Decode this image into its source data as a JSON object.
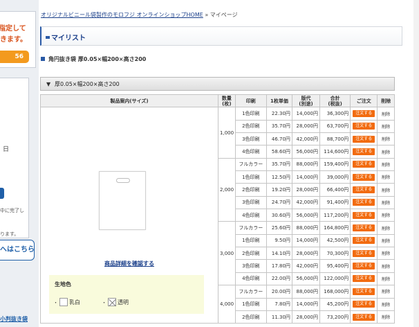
{
  "sidebar": {
    "banner_line1": "指定して",
    "banner_line2": "きます。",
    "banner_button": "56",
    "day_text": "日",
    "text1": "中に完了し",
    "text2": "",
    "text3": "ります。",
    "cta": "へはこちら",
    "bottom_link": "小判抜き袋"
  },
  "breadcrumb": {
    "home_link": "オリジナルビニール袋製作のモロフジ オンラインショップHOME",
    "separator": " » ",
    "current": "マイページ"
  },
  "header": {
    "title": "マイリスト"
  },
  "product": {
    "title": "角円抜き袋 厚0.05×幅200×高さ200",
    "section_label": "厚0.05×幅200×高さ200",
    "detail_link": "商品詳細を確認する",
    "color_heading": "生地色",
    "colors": [
      "乳白",
      "透明"
    ]
  },
  "table": {
    "headers": {
      "info": "製品案内(サイズ)",
      "qty": "数量\n(枚)",
      "print": "印刷",
      "unit": "1枚単価",
      "plate": "版代\n(別途)",
      "total": "合計\n(税抜)",
      "order": "ご注文",
      "delete": "削除"
    },
    "order_label": "注文する",
    "delete_label": "削除",
    "groups": [
      {
        "qty": "1,000",
        "rows": [
          {
            "print": "1色印刷",
            "unit": "22.30円",
            "plate": "14,000円",
            "total": "36,300円"
          },
          {
            "print": "2色印刷",
            "unit": "35.70円",
            "plate": "28,000円",
            "total": "63,700円"
          },
          {
            "print": "3色印刷",
            "unit": "46.70円",
            "plate": "42,000円",
            "total": "88,700円"
          },
          {
            "print": "4色印刷",
            "unit": "58.60円",
            "plate": "56,000円",
            "total": "114,600円"
          }
        ]
      },
      {
        "qty": "2,000",
        "rows": [
          {
            "print": "フルカラー",
            "unit": "35.70円",
            "plate": "88,000円",
            "total": "159,400円"
          },
          {
            "print": "1色印刷",
            "unit": "12.50円",
            "plate": "14,000円",
            "total": "39,000円"
          },
          {
            "print": "2色印刷",
            "unit": "19.20円",
            "plate": "28,000円",
            "total": "66,400円"
          },
          {
            "print": "3色印刷",
            "unit": "24.70円",
            "plate": "42,000円",
            "total": "91,400円"
          },
          {
            "print": "4色印刷",
            "unit": "30.60円",
            "plate": "56,000円",
            "total": "117,200円"
          }
        ]
      },
      {
        "qty": "3,000",
        "rows": [
          {
            "print": "フルカラー",
            "unit": "25.60円",
            "plate": "88,000円",
            "total": "164,800円"
          },
          {
            "print": "1色印刷",
            "unit": "9.50円",
            "plate": "14,000円",
            "total": "42,500円"
          },
          {
            "print": "2色印刷",
            "unit": "14.10円",
            "plate": "28,000円",
            "total": "70,300円"
          },
          {
            "print": "3色印刷",
            "unit": "17.80円",
            "plate": "42,000円",
            "total": "95,400円"
          },
          {
            "print": "4色印刷",
            "unit": "22.00円",
            "plate": "56,000円",
            "total": "122,000円"
          }
        ]
      },
      {
        "qty": "4,000",
        "rows": [
          {
            "print": "フルカラー",
            "unit": "20.00円",
            "plate": "88,000円",
            "total": "168,000円"
          },
          {
            "print": "1色印刷",
            "unit": "7.80円",
            "plate": "14,000円",
            "total": "45,200円"
          },
          {
            "print": "2色印刷",
            "unit": "11.30円",
            "plate": "28,000円",
            "total": "73,200円"
          }
        ]
      }
    ]
  },
  "colors": {
    "accent_blue": "#1a3f8a",
    "order_orange": "#f26b0f",
    "color_box_bg": "#f9fbdc"
  }
}
